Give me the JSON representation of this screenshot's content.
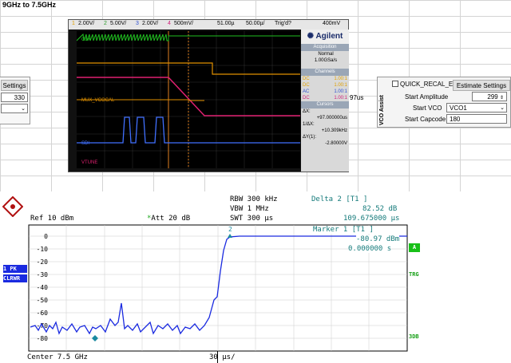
{
  "sheet": {
    "title": "9GHz to 7.5GHz"
  },
  "left_panel": {
    "settings_btn": "Settings",
    "value": "330"
  },
  "scope": {
    "brand": "Agilent",
    "acq_head": "Acquisition",
    "acq_mode": "Normal",
    "acq_rate": "1.00GSa/s",
    "channels_head": "Channels",
    "channels": [
      {
        "cpl": "DC",
        "val": "1.00:1",
        "color": "#e0a000"
      },
      {
        "cpl": "DC",
        "val": "1.00:1",
        "color": "#e0a000"
      },
      {
        "cpl": "AC",
        "val": "1.00:1",
        "color": "#3050d0"
      },
      {
        "cpl": "DC",
        "val": "1.00:1",
        "color": "#d0207a"
      }
    ],
    "cursors_head": "Cursors",
    "dx_label": "ΔX:",
    "dx_val": "+97.000000us",
    "inv_label": "1/ΔX:",
    "inv_val": "+10.309kHz",
    "dy_label": "ΔY(1):",
    "dy_val": "-2.80000V",
    "top": {
      "ch1": "2.00V/",
      "ch2": "5.00V/",
      "ch3": "2.00V/",
      "ch4": "500mV/",
      "time": "51.00µ",
      "div": "50.00µ/",
      "trig": "Trig'd?",
      "trig_lvl": "400mV"
    },
    "traces": [
      "CLK",
      "MUX_VCOCAL",
      "SDI",
      "VTUNE"
    ]
  },
  "delta_label": "97us",
  "vco": {
    "title": "VCO Assist",
    "quick_recal": "QUICK_RECAL_EN",
    "estimate_btn": "Estimate Settings",
    "start_amp_label": "Start Amplitude",
    "start_amp_val": "299",
    "start_vco_label": "Start VCO",
    "start_vco_val": "VCO1",
    "start_cap_label": "Start Capcode",
    "start_cap_val": "180"
  },
  "spectrum": {
    "rbw": "RBW 300 kHz",
    "vbw": "VBW 1 MHz",
    "swt": "SWT 300 µs",
    "ref": "Ref  10 dBm",
    "att": "Att  20 dB",
    "delta2": "Delta 2 [T1 ]",
    "delta2_db": "82.52 dB",
    "delta2_t": "109.675000 µs",
    "marker1": "Marker 1 [T1 ]",
    "marker1_db": "-80.97 dBm",
    "marker1_t": "0.000000 s",
    "center": "Center 7.5 GHz",
    "span": "30 µs/",
    "pk": "1 PK",
    "clrwr": "CLRWR",
    "tag_a": "A",
    "tag_trg": "TRG",
    "tag_3db": "3DB",
    "yticks": [
      "0",
      "-10",
      "-20",
      "-30",
      "-40",
      "-50",
      "-60",
      "-70",
      "-80"
    ],
    "marker2_num": "2"
  }
}
